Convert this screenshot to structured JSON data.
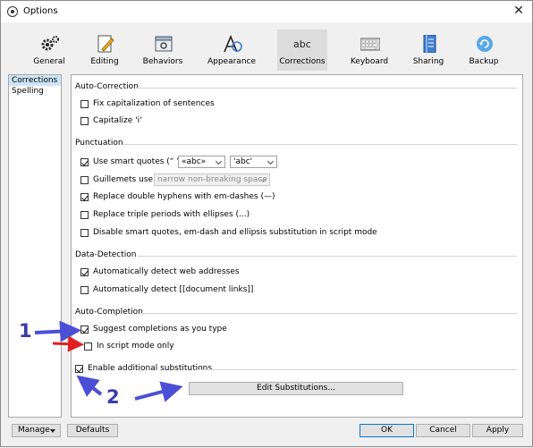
{
  "window": {
    "title": "Options",
    "close": "✕"
  },
  "toolbar": [
    {
      "label": "General",
      "icon": "gears-icon"
    },
    {
      "label": "Editing",
      "icon": "pencil-icon"
    },
    {
      "label": "Behaviors",
      "icon": "window-gear-icon"
    },
    {
      "label": "Appearance",
      "icon": "font-a-icon"
    },
    {
      "label": "Corrections",
      "icon": "abc-icon",
      "active": true,
      "icon_text": "abc"
    },
    {
      "label": "Keyboard",
      "icon": "keyboard-icon"
    },
    {
      "label": "Sharing",
      "icon": "book-icon"
    },
    {
      "label": "Backup",
      "icon": "backup-icon"
    }
  ],
  "sidebar": {
    "items": [
      "Corrections",
      "Spelling"
    ]
  },
  "sections": {
    "autocorrection": "Auto-Correction",
    "punctuation": "Punctuation",
    "datadetection": "Data-Detection",
    "autocompletion": "Auto-Completion"
  },
  "options": {
    "fix_caps": {
      "label": "Fix capitalization of sentences",
      "checked": false
    },
    "capitalize_i": {
      "label": "Capitalize 'i'",
      "checked": false
    },
    "smart_quotes": {
      "label": "Use smart quotes (“ ”)",
      "checked": true,
      "double": "«abc»",
      "single": "'abc'"
    },
    "guillemets": {
      "label": "Guillemets use",
      "checked": false,
      "value": "narrow non-breaking space"
    },
    "hyphens": {
      "label": "Replace double hyphens with em-dashes (—)",
      "checked": true
    },
    "periods": {
      "label": "Replace triple periods with ellipses (...)",
      "checked": false
    },
    "disable_script": {
      "label": "Disable smart quotes, em-dash and ellipsis substitution in script mode",
      "checked": false
    },
    "web_addresses": {
      "label": "Automatically detect web addresses",
      "checked": true
    },
    "doc_links": {
      "label": "Automatically detect [[document links]]",
      "checked": false
    },
    "suggest": {
      "label": "Suggest completions as you type",
      "checked": true
    },
    "script_only": {
      "label": "In script mode only",
      "checked": false
    },
    "additional": {
      "label": "Enable additional substitutions",
      "checked": true
    }
  },
  "edit_substitutions": "Edit Substitutions...",
  "bottom": {
    "manage": "Manage",
    "defaults": "Defaults",
    "ok": "OK",
    "cancel": "Cancel",
    "apply": "Apply"
  },
  "annotations": {
    "one": "1",
    "two": "2"
  },
  "colors": {
    "arrow_blue": "#4a4fd6",
    "arrow_red": "#e02020",
    "selection": "#cce4f7",
    "primary_border": "#0078d7"
  }
}
